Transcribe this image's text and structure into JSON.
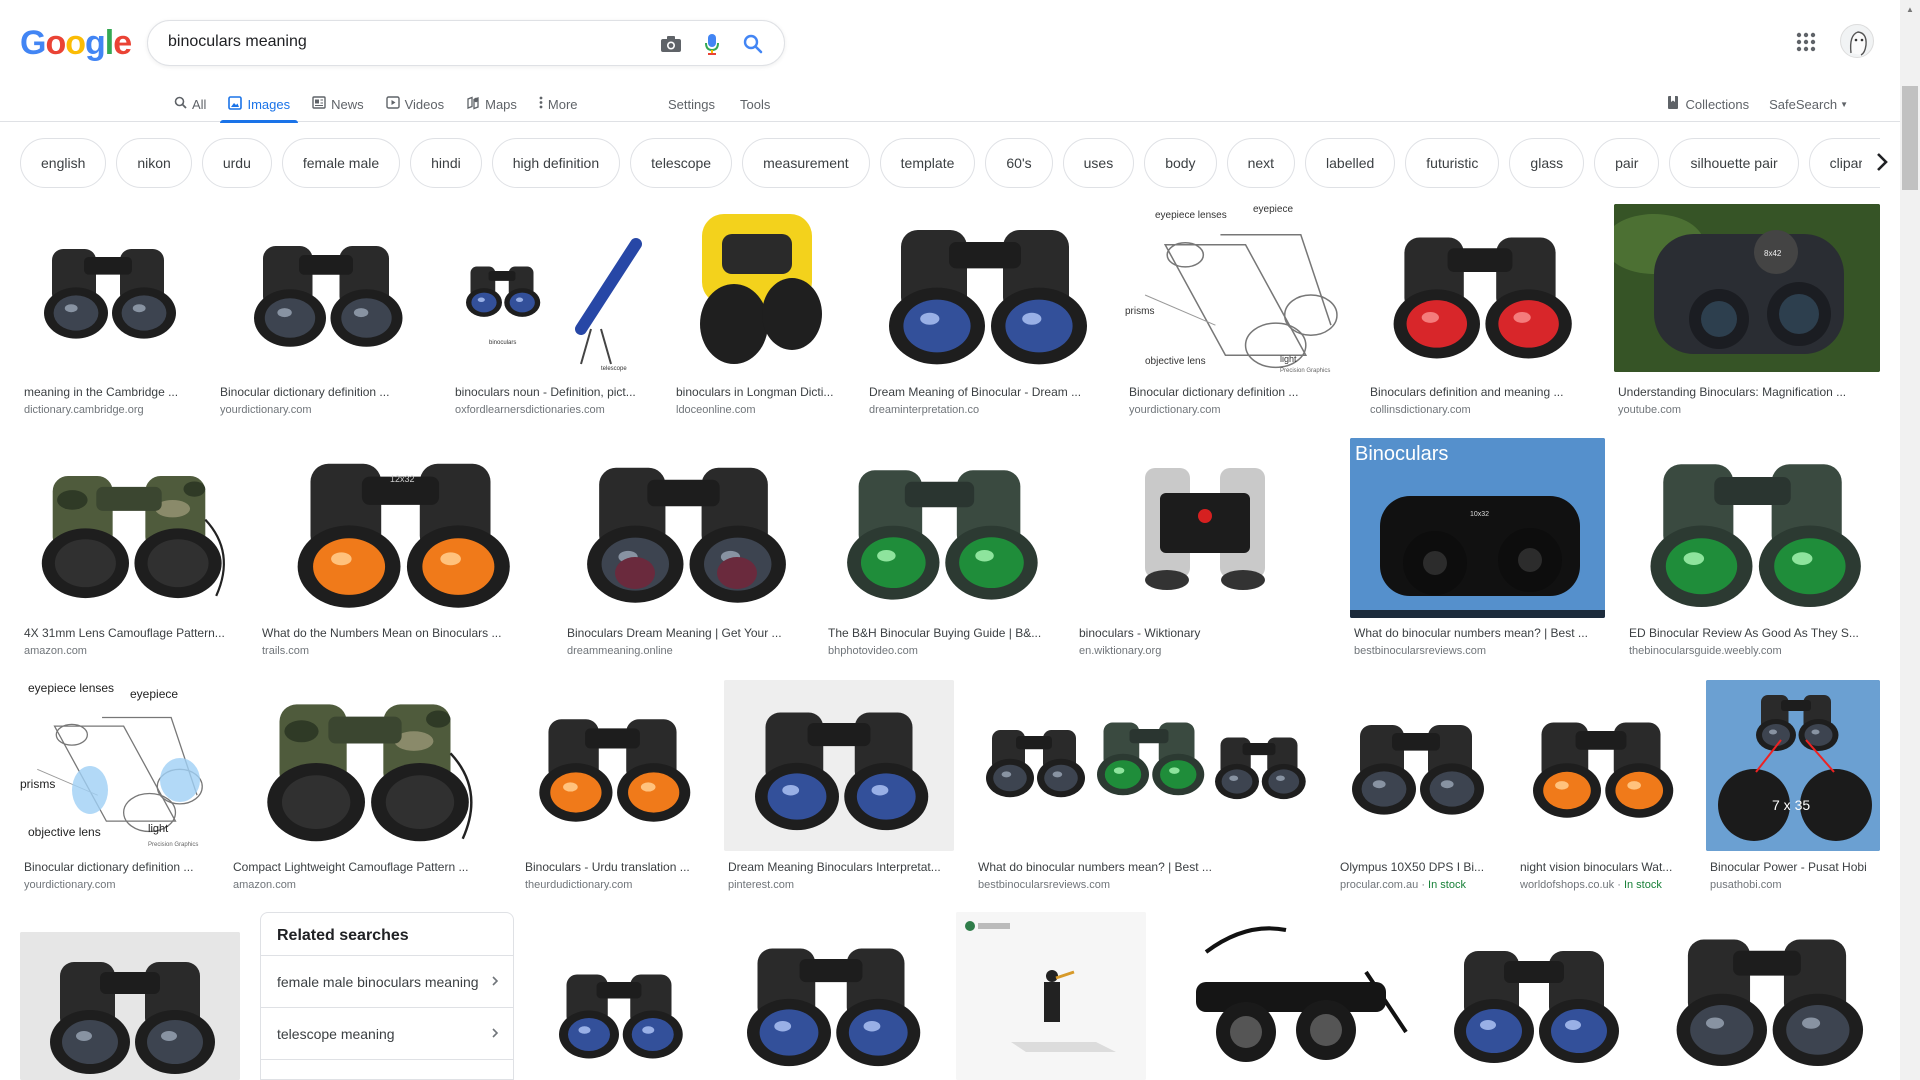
{
  "logo": "Google",
  "search": {
    "query": "binoculars meaning"
  },
  "tabs": [
    {
      "label": "All",
      "icon": "search-icon"
    },
    {
      "label": "Images",
      "icon": "image-icon",
      "active": true
    },
    {
      "label": "News",
      "icon": "news-icon"
    },
    {
      "label": "Videos",
      "icon": "video-icon"
    },
    {
      "label": "Maps",
      "icon": "map-icon"
    },
    {
      "label": "More",
      "icon": "more-vert-icon"
    }
  ],
  "tools": {
    "settings": "Settings",
    "tools": "Tools",
    "collections": "Collections",
    "safesearch": "SafeSearch"
  },
  "chips": [
    "english",
    "nikon",
    "urdu",
    "female male",
    "hindi",
    "high definition",
    "telescope",
    "measurement",
    "template",
    "60's",
    "uses",
    "body",
    "next",
    "labelled",
    "futuristic",
    "glass",
    "pair",
    "silhouette pair",
    "clipart binoculars"
  ],
  "results": [
    {
      "title": "meaning in the Cambridge ...",
      "site": "dictionary.cambridge.org"
    },
    {
      "title": "Binocular dictionary definition ...",
      "site": "yourdictionary.com"
    },
    {
      "title": "binoculars noun - Definition, pict...",
      "site": "oxfordlearnersdictionaries.com"
    },
    {
      "title": "binoculars in Longman Dicti...",
      "site": "ldoceonline.com"
    },
    {
      "title": "Dream Meaning of Binocular - Dream ...",
      "site": "dreaminterpretation.co"
    },
    {
      "title": "Binocular dictionary definition ...",
      "site": "yourdictionary.com"
    },
    {
      "title": "Binoculars definition and meaning ...",
      "site": "collinsdictionary.com"
    },
    {
      "title": "Understanding Binoculars: Magnification ...",
      "site": "youtube.com"
    },
    {
      "title": "4X 31mm Lens Camouflage Pattern...",
      "site": "amazon.com"
    },
    {
      "title": "What do the Numbers Mean on Binoculars ...",
      "site": "trails.com"
    },
    {
      "title": "Binoculars Dream Meaning | Get Your ...",
      "site": "dreammeaning.online"
    },
    {
      "title": "The B&H Binocular Buying Guide | B&...",
      "site": "bhphotovideo.com"
    },
    {
      "title": "binoculars - Wiktionary",
      "site": "en.wiktionary.org"
    },
    {
      "title": "What do binocular numbers mean? | Best ...",
      "site": "bestbinocularsreviews.com"
    },
    {
      "title": "ED Binocular Review As Good As They S...",
      "site": "thebinocularsguide.weebly.com"
    },
    {
      "title": "Binocular dictionary definition ...",
      "site": "yourdictionary.com"
    },
    {
      "title": "Compact Lightweight Camouflage Pattern ...",
      "site": "amazon.com"
    },
    {
      "title": "Binoculars - Urdu translation ...",
      "site": "theurdudictionary.com"
    },
    {
      "title": "Dream Meaning Binoculars Interpretat...",
      "site": "pinterest.com"
    },
    {
      "title": "What do binocular numbers mean? | Best ...",
      "site": "bestbinocularsreviews.com"
    },
    {
      "title": "Olympus 10X50 DPS I Bi...",
      "site": "procular.com.au",
      "stock": "In stock"
    },
    {
      "title": "night vision binoculars Wat...",
      "site": "worldofshops.co.uk",
      "stock": "In stock"
    },
    {
      "title": "Binocular Power - Pusat Hobi",
      "site": "pusathobi.com"
    }
  ],
  "thumb_text": {
    "eyepiece_lenses": "eyepiece lenses",
    "eyepiece": "eyepiece",
    "prisms": "prisms",
    "objective_lens": "objective lens",
    "light": "light",
    "precision_graphics": "Precision Graphics",
    "binoculars_label": "binoculars",
    "telescope_label": "telescope",
    "binoculars_banner": "Binoculars",
    "magnification": "7 x 35",
    "size_12x32": "12x32",
    "size_8x42": "8x42",
    "lens_10x32": "10x32"
  },
  "related": {
    "heading": "Related searches",
    "items": [
      "female male binoculars meaning",
      "telescope meaning"
    ]
  }
}
